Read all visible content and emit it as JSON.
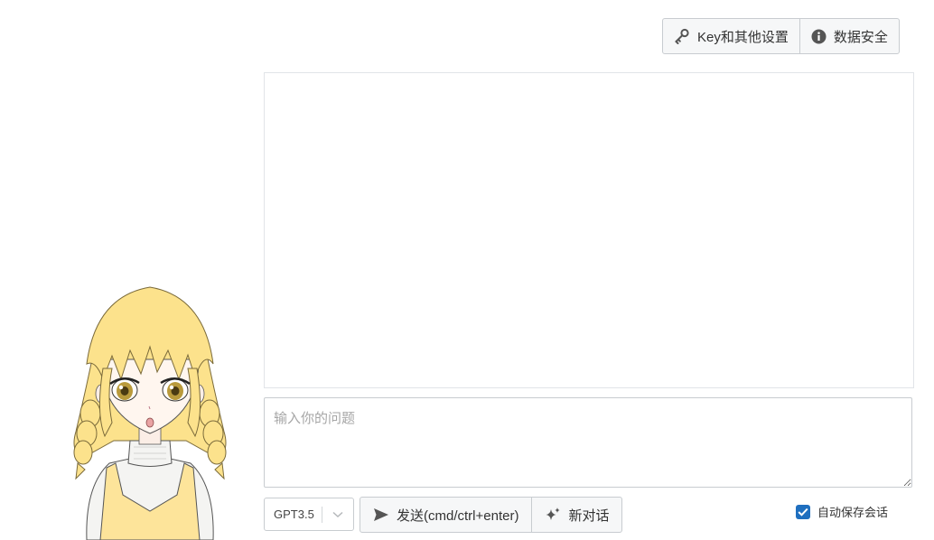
{
  "header": {
    "key_settings_label": "Key和其他设置",
    "data_security_label": "数据安全"
  },
  "input": {
    "placeholder": "输入你的问题"
  },
  "toolbar": {
    "model_value": "GPT3.5",
    "send_label": "发送(cmd/ctrl+enter)",
    "new_chat_label": "新对话",
    "autosave_label": "自动保存会话",
    "autosave_checked": true
  },
  "icons": {
    "key": "key-icon",
    "info": "info-circle-icon",
    "send": "paper-plane-icon",
    "new_chat": "sparkles-icon",
    "dropdown": "chevron-down-icon",
    "check": "check-icon"
  },
  "colors": {
    "accent": "#1f6fbf",
    "button_bg": "#f6f7f8",
    "border": "#c8ccd0",
    "avatar_hair": "#fce28c",
    "avatar_apron": "#fde49a"
  }
}
